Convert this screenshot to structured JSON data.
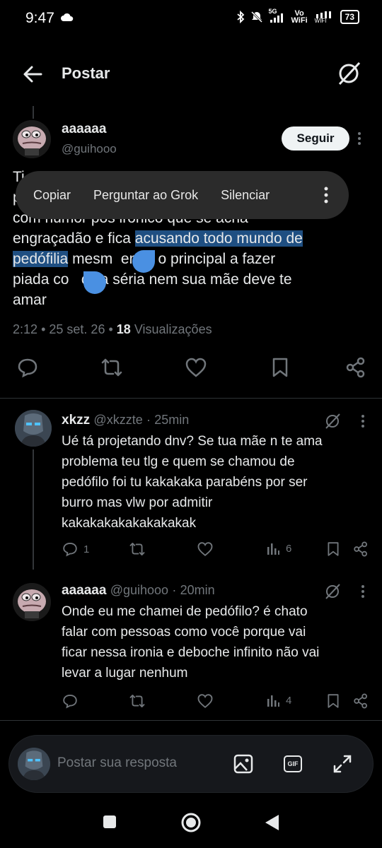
{
  "status_bar": {
    "time": "9:47",
    "network": "5G",
    "vo_wifi_top": "Vo",
    "vo_wifi_bottom": "WiFi",
    "wifi_label": "WIFI",
    "battery": "73"
  },
  "header": {
    "title": "Postar"
  },
  "main_post": {
    "author_name": "aaaaaa",
    "author_handle": "@guihooo",
    "follow_label": "Seguir",
    "text_line1": "Ti",
    "text_line2": "p",
    "text_line3": "com humor pós irônico que se acha",
    "text_line4_plain": "engraçadão e fica ",
    "text_line4_hl": "acusando todo mundo de",
    "text_line5_hl": "pedófilia",
    "text_line5_plain": " mesm  endo o principal a fazer",
    "text_line6": "piada co   oisa séria nem sua mãe deve te",
    "text_line7": "amar",
    "time": "2:12",
    "sep1": "•",
    "date": "25 set. 26",
    "sep2": "•",
    "views_count": "18",
    "views_label": "Visualizações"
  },
  "context_menu": {
    "items": [
      "Copiar",
      "Perguntar ao Grok",
      "Silenciar"
    ]
  },
  "replies": [
    {
      "name": "xkzz",
      "handle": "@xkzzte",
      "sep": "·",
      "time": "25min",
      "text_lines": [
        "Ué tá projetando dnv? Se tua mãe n te ama",
        "problema teu tlg e quem se chamou de",
        "pedófilo foi tu kakakaka parabéns por ser",
        "burro mas vlw por admitir",
        "kakakakakakakakakak"
      ],
      "reply_count": "1",
      "views": "6"
    },
    {
      "name": "aaaaaa",
      "handle": "@guihooo",
      "sep": "·",
      "time": "20min",
      "text_lines": [
        "Onde eu me chamei de pedófilo? é chato",
        "falar com pessoas como você porque vai",
        "ficar nessa ironia e deboche infinito não vai",
        "levar a lugar nenhum"
      ],
      "reply_count": "",
      "views": "4"
    }
  ],
  "composer": {
    "placeholder": "Postar sua resposta",
    "gif_label": "GIF"
  },
  "colors": {
    "background": "#000000",
    "text": "#e7e9ea",
    "muted": "#71767b",
    "highlight": "#1f4f82",
    "selection_handle": "#4a90e2"
  },
  "icons": [
    "back-arrow-icon",
    "grok-icon",
    "reply-icon",
    "repost-icon",
    "like-icon",
    "bookmark-icon",
    "share-icon",
    "views-icon",
    "image-icon",
    "gif-icon",
    "expand-icon"
  ]
}
